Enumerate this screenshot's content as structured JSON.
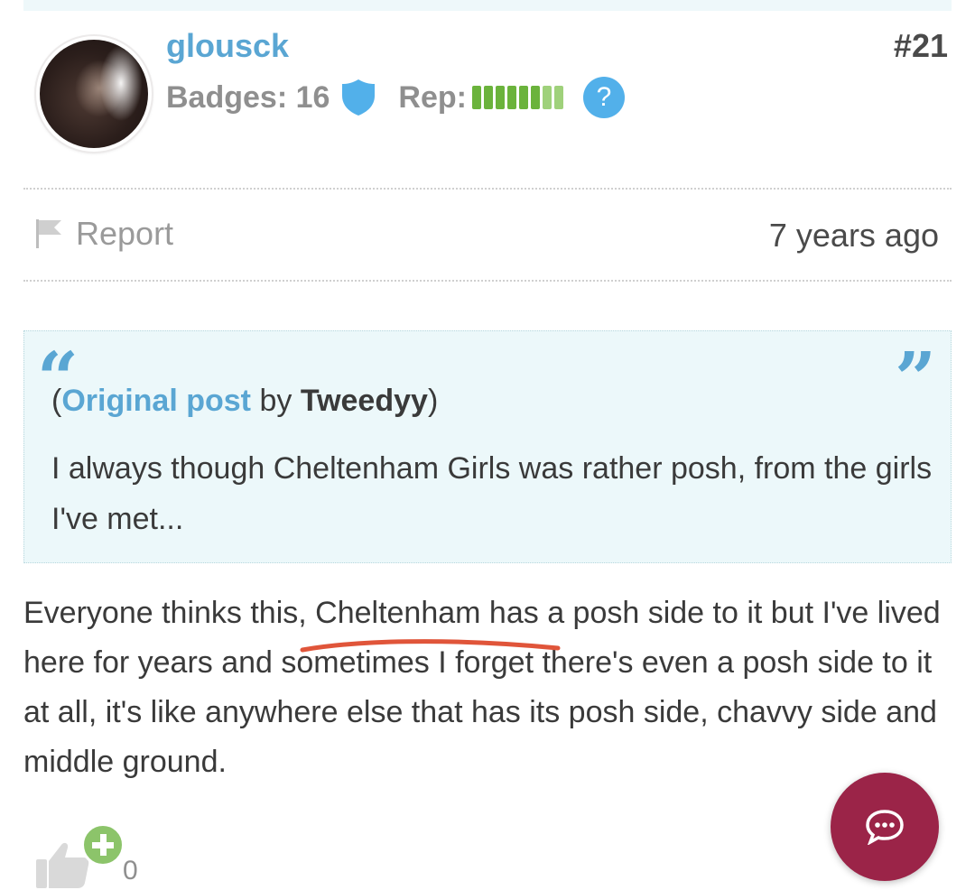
{
  "post": {
    "username": "glousck",
    "post_number": "#21",
    "badges_label": "Badges: 16",
    "rep_label": "Rep:",
    "rep_help": "?",
    "report_label": "Report",
    "time_ago": "7 years ago"
  },
  "quote": {
    "open_mark": "“",
    "close_mark": "”",
    "paren_open": "(",
    "original_post_link": "Original post",
    "by_text": " by ",
    "author": "Tweedyy",
    "paren_close": ")",
    "text": "I always though Cheltenham Girls was rather posh, from the girls I've met..."
  },
  "body": {
    "text": "Everyone thinks this, Cheltenham has a posh side to it but I've lived here for years and sometimes I forget there's even a posh side to it at all, it's like anywhere else that has its posh side, chavvy side and middle ground."
  },
  "actions": {
    "like_count": "0"
  },
  "colors": {
    "link_blue": "#5aa6d3",
    "rep_green": "#6bb33c",
    "chat_button": "#9b2448",
    "quote_background": "#ecf8fa",
    "annotation_red": "#e0553a"
  },
  "icons": {
    "badge": "shield-icon",
    "help": "question-circle-icon",
    "report": "flag-icon",
    "like": "thumbs-up-icon",
    "like_plus": "plus-circle-icon",
    "chat": "chat-bubble-icon"
  }
}
